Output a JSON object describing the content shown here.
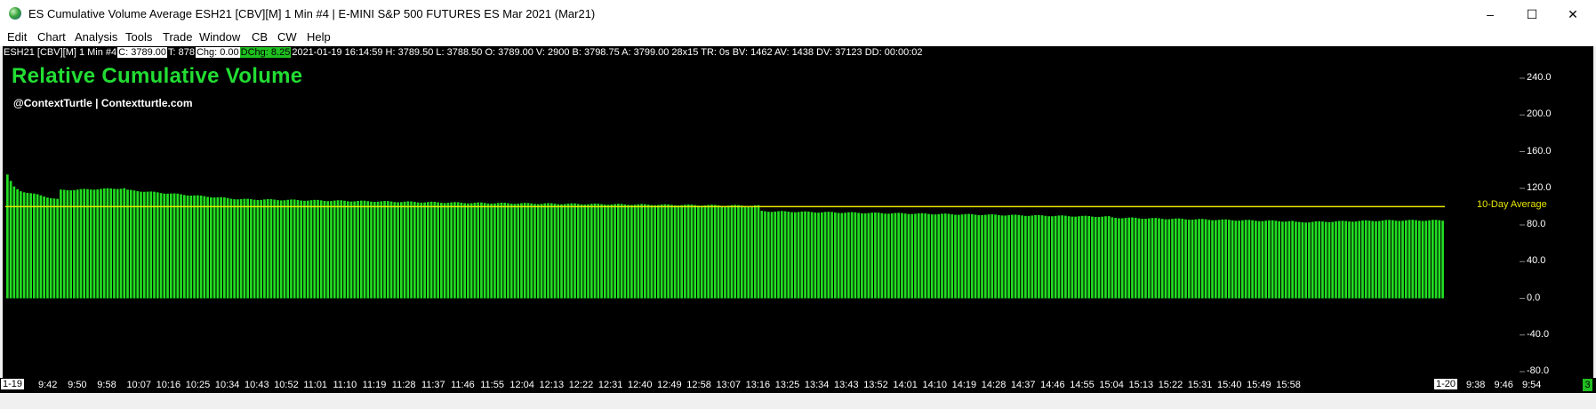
{
  "window": {
    "title": "ES Cumulative Volume Average ESH21 [CBV][M]  1 Min   #4 | E-MINI S&P 500 FUTURES ES Mar 2021 (Mar21)",
    "minimize": "–",
    "maximize": "☐",
    "close": "✕"
  },
  "menu": [
    "Edit",
    "Chart",
    "Analysis",
    "Tools",
    "Trade",
    "Window",
    "CB",
    "CW",
    "Help"
  ],
  "infobar": {
    "symbol": "ESH21 [CBV][M]  1 Min   #4",
    "close": "C: 3789.00",
    "ticks": "T: 878",
    "chg": "Chg: 0.00",
    "dchg": "DChg: 8.25",
    "rest": "2021-01-19 16:14:59 H: 3789.50 L: 3788.50 O: 3789.00 V: 2900 B: 3798.75 A: 3799.00 28x15 TR: 0s BV: 1462 AV: 1438 DV: 37123 DD: 00:00:02"
  },
  "study": {
    "title": "Relative Cumulative Volume",
    "subtitle": "@ContextTurtle | Contextturtle.com",
    "average_label": "10-Day Average"
  },
  "colors": {
    "bar": "#22dd22",
    "average_line": "#e8e800",
    "title": "#22dd33",
    "background": "#000000"
  },
  "chart_data": {
    "type": "bar",
    "series": [
      {
        "name": "Relative Cumulative Volume",
        "segments": [
          {
            "from_bar": 0,
            "to_bar": 3,
            "values": [
              135,
              128,
              122,
              119
            ]
          },
          {
            "from_bar": 4,
            "to_bar": 15,
            "start": 117,
            "end": 108
          },
          {
            "from_bar": 16,
            "to_bar": 35,
            "start": 118,
            "end": 120
          },
          {
            "from_bar": 36,
            "to_bar": 70,
            "start": 118,
            "end": 108
          },
          {
            "from_bar": 71,
            "to_bar": 140,
            "start": 108,
            "end": 104
          },
          {
            "from_bar": 141,
            "to_bar": 225,
            "start": 104,
            "end": 101
          },
          {
            "from_bar": 226,
            "to_bar": 260,
            "start": 95,
            "end": 93
          },
          {
            "from_bar": 261,
            "to_bar": 330,
            "start": 93,
            "end": 89
          },
          {
            "from_bar": 331,
            "to_bar": 385,
            "start": 88,
            "end": 84
          },
          {
            "from_bar": 386,
            "to_bar": 415,
            "start": 83,
            "end": 85
          },
          {
            "from_bar": 416,
            "to_bar": 430,
            "start": 85,
            "end": 85
          }
        ],
        "bar_count": 431
      }
    ],
    "average": 100,
    "ylim": [
      -80,
      240
    ],
    "yticks": [
      "240.0",
      "200.0",
      "160.0",
      "120.0",
      "80.0",
      "40.0",
      "0.0",
      "-40.0",
      "-80.0"
    ],
    "xticks": [
      "9:42",
      "9:50",
      "9:58",
      "10:07",
      "10:16",
      "10:25",
      "10:34",
      "10:43",
      "10:52",
      "11:01",
      "11:10",
      "11:19",
      "11:28",
      "11:37",
      "11:46",
      "11:55",
      "12:04",
      "12:13",
      "12:22",
      "12:31",
      "12:40",
      "12:49",
      "12:58",
      "13:07",
      "13:16",
      "13:25",
      "13:34",
      "13:43",
      "13:52",
      "14:01",
      "14:10",
      "14:19",
      "14:28",
      "14:37",
      "14:46",
      "14:55",
      "15:04",
      "15:13",
      "15:22",
      "15:31",
      "15:40",
      "15:49",
      "15:58"
    ],
    "xticks_next": [
      "9:38",
      "9:46",
      "9:54"
    ],
    "x_start_badge": "1-19",
    "x_next_badge": "1-20",
    "corner_badge": "3"
  }
}
